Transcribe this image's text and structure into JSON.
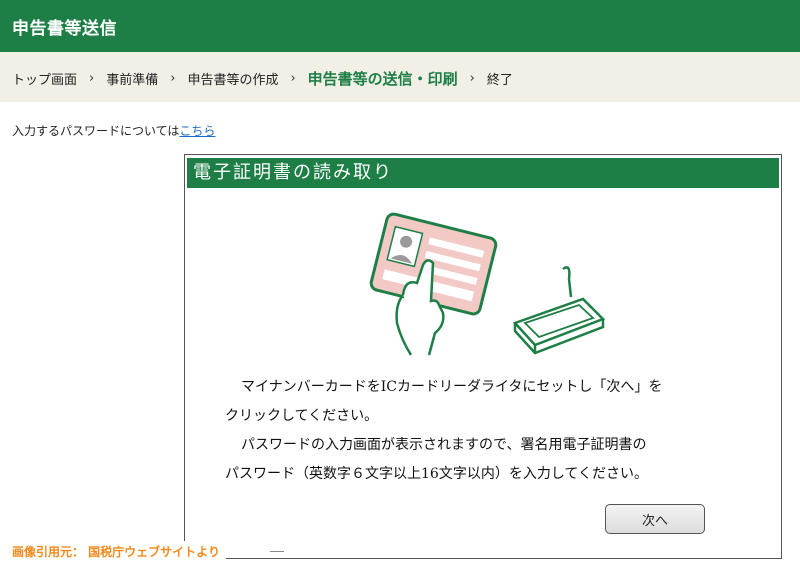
{
  "header": {
    "title": "申告書等送信"
  },
  "breadcrumb": {
    "items": [
      "トップ画面",
      "事前準備",
      "申告書等の作成",
      "申告書等の送信・印刷",
      "終了"
    ],
    "separator": "›"
  },
  "password_notice": {
    "text": "入力するパスワードについては",
    "link": "こちら"
  },
  "dialog": {
    "title": "電子証明書の読み取り",
    "message_line1": "マイナンバーカードをICカードリーダライタにセットし「次へ」を",
    "message_line2": "クリックしてください。",
    "message_line3": "パスワードの入力画面が表示されますので、署名用電子証明書の",
    "message_line4": "パスワード（英数字６文字以上16文字以内）を入力してください。",
    "next_button": "次へ"
  },
  "credit": "画像引用元： 国税庁ウェブサイトより",
  "colors": {
    "brand_green": "#1d7f45",
    "crumb_bg": "#f1efe6",
    "credit_orange": "#f08a1c",
    "link_blue": "#1a6bc8"
  }
}
